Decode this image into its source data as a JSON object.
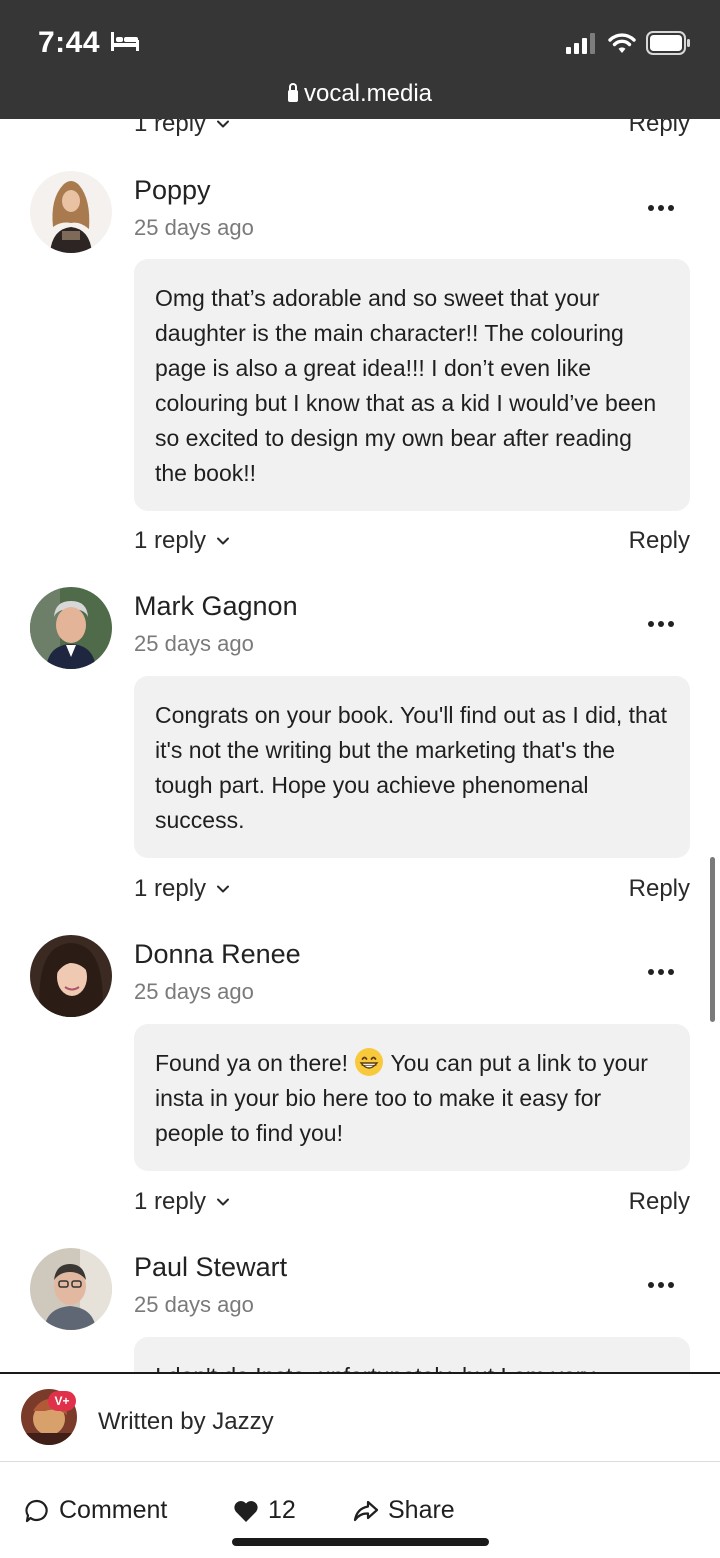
{
  "status_bar": {
    "time": "7:44"
  },
  "browser": {
    "url": "vocal.media"
  },
  "top_partial_row": {
    "replies_label": "1 reply",
    "reply_label": "Reply"
  },
  "comments": [
    {
      "author": "Poppy",
      "time": "25 days ago",
      "body": "Omg that’s adorable and so sweet that your daughter is the main character!! The colouring page is also a great idea!!! I don’t even like colouring but I know that as a kid I would’ve been so excited to design my own bear after reading the book!!",
      "replies_label": "1 reply",
      "reply_label": "Reply"
    },
    {
      "author": "Mark Gagnon",
      "time": "25 days ago",
      "body": "Congrats on your book. You'll find out as I did, that it's not the writing but the marketing that's the tough part. Hope you achieve phenomenal success.",
      "replies_label": "1 reply",
      "reply_label": "Reply"
    },
    {
      "author": "Donna Renee",
      "time": "25 days ago",
      "body_before_emoji": "Found ya on there!",
      "body_after_emoji": "You can put a link to your insta in your bio here too to make it easy for people to find you!",
      "replies_label": "1 reply",
      "reply_label": "Reply"
    },
    {
      "author": "Paul Stewart",
      "time": "25 days ago",
      "body": "I don't do Insta, unfortunately, but I am very"
    }
  ],
  "footer": {
    "badge": "V+",
    "written_by": "Written by Jazzy",
    "comment_label": "Comment",
    "like_count": "12",
    "share_label": "Share"
  },
  "icons": [
    "bed-icon",
    "signal-icon",
    "wifi-icon",
    "battery-icon",
    "lock-icon",
    "chevron-down-icon",
    "more-icon",
    "grin-emoji-icon",
    "comment-icon",
    "heart-icon",
    "share-icon"
  ]
}
